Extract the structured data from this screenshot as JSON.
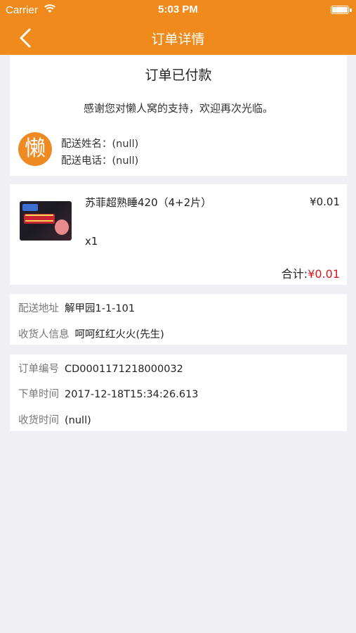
{
  "status_bar": {
    "carrier": "Carrier",
    "time": "5:03 PM",
    "icons": [
      "wifi-icon",
      "battery-icon"
    ]
  },
  "nav": {
    "title": "订单详情",
    "back_icon": "chevron-left-icon"
  },
  "order_status": {
    "title": "订单已付款",
    "thanks": "感谢您对懒人窝的支持，欢迎再次光临。",
    "logo_char": "懒",
    "delivery_name": "配送姓名：(null)",
    "delivery_phone": "配送电话：(null)"
  },
  "product": {
    "name": "苏菲超熟睡420（4+2片）",
    "price": "¥0.01",
    "quantity": "x1",
    "total_label": "合计:",
    "total_amount": "¥0.01"
  },
  "address": {
    "address_label": "配送地址",
    "address_value": "解甲园1-1-101",
    "receiver_label": "收货人信息",
    "receiver_value": "呵呵红红火火(先生)"
  },
  "order_info": {
    "number_label": "订单编号",
    "number_value": "CD0001171218000032",
    "time_label": "下单时间",
    "time_value": "2017-12-18T15:34:26.613",
    "receive_label": "收货时间",
    "receive_value": "(null)"
  },
  "colors": {
    "brand": "#f08a1c",
    "price_red": "#e0141e",
    "background": "#efeff4"
  }
}
